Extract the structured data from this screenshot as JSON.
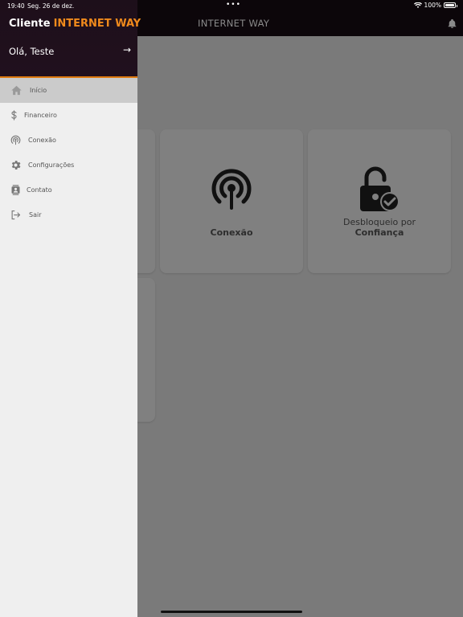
{
  "status": {
    "time": "19:40",
    "date": "Seg. 26 de dez.",
    "battery": "100%"
  },
  "appbar": {
    "title": "INTERNET WAY"
  },
  "drawer": {
    "brand_prefix": "Cliente",
    "brand_name": "INTERNET WAY",
    "greeting": "Olá, Teste",
    "items": [
      {
        "label": "Início",
        "icon": "home-icon",
        "active": true
      },
      {
        "label": "Financeiro",
        "icon": "dollar-icon"
      },
      {
        "label": "Conexão",
        "icon": "antenna-icon"
      },
      {
        "label": "Configurações",
        "icon": "gear-icon"
      },
      {
        "label": "Contato",
        "icon": "contact-icon"
      },
      {
        "label": "Sair",
        "icon": "logout-icon"
      }
    ]
  },
  "cards": [
    {
      "label_bold": "Conexão",
      "icon": "antenna-icon"
    },
    {
      "label_line1": "Desbloqueio por",
      "label_bold": "Confiança",
      "icon": "unlock-check-icon"
    }
  ],
  "colors": {
    "accent": "#f08a1c",
    "header_bg": "#1d0f1a",
    "drawer_bg": "#efefef",
    "overlay": "#7a7a7a"
  }
}
